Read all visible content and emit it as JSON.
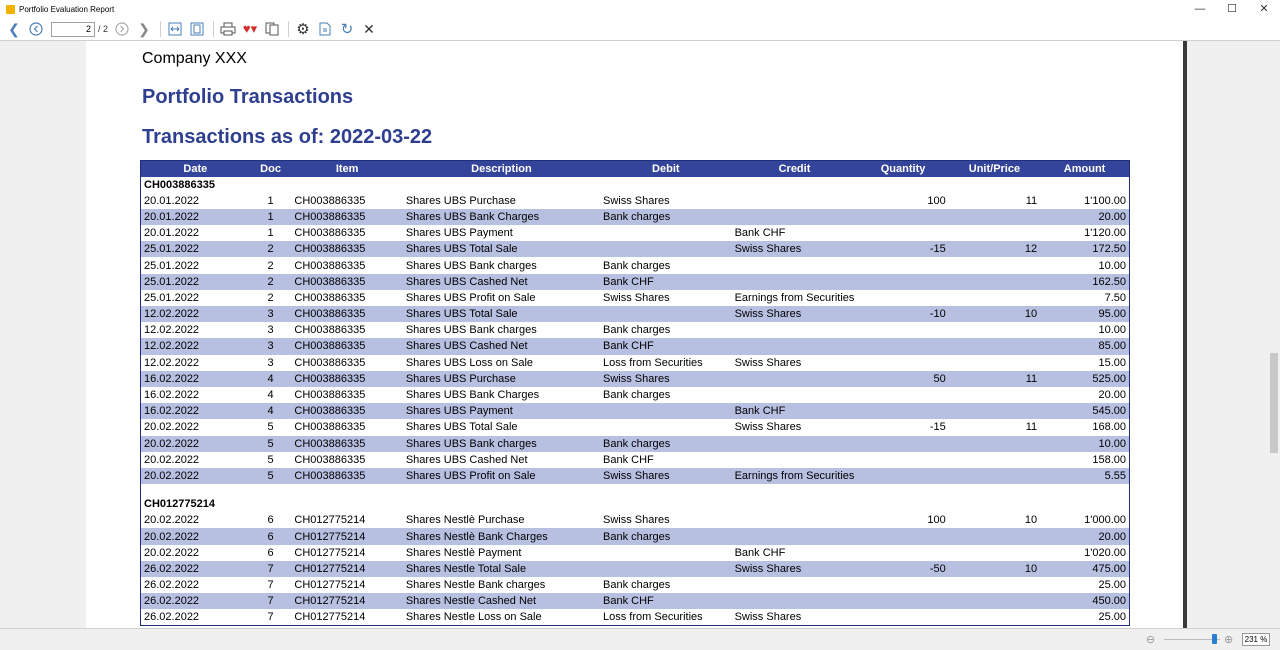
{
  "window": {
    "title": "Portfolio Evaluation Report",
    "minimize": "—",
    "maximize": "☐",
    "close": "✕"
  },
  "toolbar": {
    "page_current": "2",
    "page_total": "/ 2"
  },
  "report": {
    "company": "Company XXX",
    "title": "Portfolio Transactions",
    "subtitle": "Transactions as of: 2022-03-22"
  },
  "table": {
    "headers": [
      "Date",
      "Doc",
      "Item",
      "Description",
      "Debit",
      "Credit",
      "Quantity",
      "Unit/Price",
      "Amount"
    ],
    "groups": [
      {
        "name": "CH003886335",
        "rows": [
          [
            "20.01.2022",
            "1",
            "CH003886335",
            "Shares UBS Purchase",
            "Swiss Shares",
            "",
            "100",
            "11",
            "1'100.00"
          ],
          [
            "20.01.2022",
            "1",
            "CH003886335",
            "Shares UBS Bank Charges",
            "Bank charges",
            "",
            "",
            "",
            "20.00"
          ],
          [
            "20.01.2022",
            "1",
            "CH003886335",
            "Shares UBS Payment",
            "",
            "Bank CHF",
            "",
            "",
            "1'120.00"
          ],
          [
            "25.01.2022",
            "2",
            "CH003886335",
            "Shares UBS Total Sale",
            "",
            "Swiss Shares",
            "-15",
            "12",
            "172.50"
          ],
          [
            "25.01.2022",
            "2",
            "CH003886335",
            "Shares UBS Bank charges",
            "Bank charges",
            "",
            "",
            "",
            "10.00"
          ],
          [
            "25.01.2022",
            "2",
            "CH003886335",
            "Shares UBS Cashed Net",
            "Bank CHF",
            "",
            "",
            "",
            "162.50"
          ],
          [
            "25.01.2022",
            "2",
            "CH003886335",
            "Shares UBS Profit on Sale",
            "Swiss Shares",
            "Earnings from Securities",
            "",
            "",
            "7.50"
          ],
          [
            "12.02.2022",
            "3",
            "CH003886335",
            "Shares UBS Total Sale",
            "",
            "Swiss Shares",
            "-10",
            "10",
            "95.00"
          ],
          [
            "12.02.2022",
            "3",
            "CH003886335",
            "Shares UBS Bank charges",
            "Bank charges",
            "",
            "",
            "",
            "10.00"
          ],
          [
            "12.02.2022",
            "3",
            "CH003886335",
            "Shares UBS Cashed Net",
            "Bank CHF",
            "",
            "",
            "",
            "85.00"
          ],
          [
            "12.02.2022",
            "3",
            "CH003886335",
            "Shares UBS Loss on Sale",
            "Loss from Securities",
            "Swiss Shares",
            "",
            "",
            "15.00"
          ],
          [
            "16.02.2022",
            "4",
            "CH003886335",
            "Shares UBS Purchase",
            "Swiss Shares",
            "",
            "50",
            "11",
            "525.00"
          ],
          [
            "16.02.2022",
            "4",
            "CH003886335",
            "Shares UBS Bank Charges",
            "Bank charges",
            "",
            "",
            "",
            "20.00"
          ],
          [
            "16.02.2022",
            "4",
            "CH003886335",
            "Shares UBS Payment",
            "",
            "Bank CHF",
            "",
            "",
            "545.00"
          ],
          [
            "20.02.2022",
            "5",
            "CH003886335",
            "Shares UBS Total Sale",
            "",
            "Swiss Shares",
            "-15",
            "11",
            "168.00"
          ],
          [
            "20.02.2022",
            "5",
            "CH003886335",
            "Shares UBS Bank charges",
            "Bank charges",
            "",
            "",
            "",
            "10.00"
          ],
          [
            "20.02.2022",
            "5",
            "CH003886335",
            "Shares UBS Cashed Net",
            "Bank CHF",
            "",
            "",
            "",
            "158.00"
          ],
          [
            "20.02.2022",
            "5",
            "CH003886335",
            "Shares UBS Profit on Sale",
            "Swiss Shares",
            "Earnings from Securities",
            "",
            "",
            "5.55"
          ]
        ]
      },
      {
        "name": "CH012775214",
        "rows": [
          [
            "20.02.2022",
            "6",
            "CH012775214",
            "Shares Nestlè Purchase",
            "Swiss Shares",
            "",
            "100",
            "10",
            "1'000.00"
          ],
          [
            "20.02.2022",
            "6",
            "CH012775214",
            "Shares Nestlè Bank Charges",
            "Bank charges",
            "",
            "",
            "",
            "20.00"
          ],
          [
            "20.02.2022",
            "6",
            "CH012775214",
            "Shares Nestlè Payment",
            "",
            "Bank CHF",
            "",
            "",
            "1'020.00"
          ],
          [
            "26.02.2022",
            "7",
            "CH012775214",
            "Shares Nestle Total Sale",
            "",
            "Swiss Shares",
            "-50",
            "10",
            "475.00"
          ],
          [
            "26.02.2022",
            "7",
            "CH012775214",
            "Shares Nestle Bank charges",
            "Bank charges",
            "",
            "",
            "",
            "25.00"
          ],
          [
            "26.02.2022",
            "7",
            "CH012775214",
            "Shares Nestle Cashed Net",
            "Bank CHF",
            "",
            "",
            "",
            "450.00"
          ],
          [
            "26.02.2022",
            "7",
            "CH012775214",
            "Shares Nestle Loss on Sale",
            "Loss from Securities",
            "Swiss Shares",
            "",
            "",
            "25.00"
          ]
        ]
      }
    ]
  },
  "statusbar": {
    "zoom": "231 %",
    "zoom_level_fraction": 0.86
  },
  "colors": {
    "header_bg": "#34449a",
    "alt_row": "#b8c0e2",
    "title": "#2e3f8f"
  }
}
